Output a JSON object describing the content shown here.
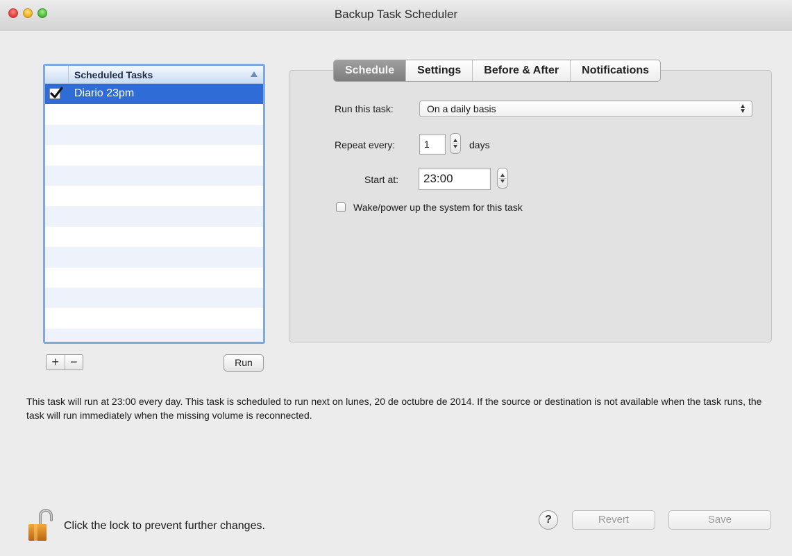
{
  "window": {
    "title": "Backup Task Scheduler"
  },
  "task_list": {
    "header": "Scheduled Tasks",
    "items": [
      {
        "name": "Diario 23pm",
        "checked": true,
        "selected": true
      }
    ],
    "add_label": "+",
    "remove_label": "−",
    "run_label": "Run"
  },
  "tabs": [
    {
      "label": "Schedule",
      "active": true
    },
    {
      "label": "Settings",
      "active": false
    },
    {
      "label": "Before & After",
      "active": false
    },
    {
      "label": "Notifications",
      "active": false
    }
  ],
  "schedule": {
    "run_label": "Run this task:",
    "run_value": "On a daily basis",
    "repeat_label": "Repeat every:",
    "repeat_value": "1",
    "repeat_unit": "days",
    "start_label": "Start at:",
    "start_value": "23:00",
    "wake_label": "Wake/power up the system for this task",
    "wake_checked": false
  },
  "description": "This task will run at 23:00 every day. This task is scheduled to run next on lunes, 20 de octubre de 2014. If the source or destination is not available when the task runs, the task will run immediately when the missing volume is reconnected.",
  "footer": {
    "lock_text": "Click the lock to prevent further changes.",
    "help_label": "?",
    "revert_label": "Revert",
    "save_label": "Save"
  },
  "colors": {
    "selection": "#2f6cd6",
    "list_border": "#7fa8de",
    "disabled_text": "#9a9a9a"
  }
}
